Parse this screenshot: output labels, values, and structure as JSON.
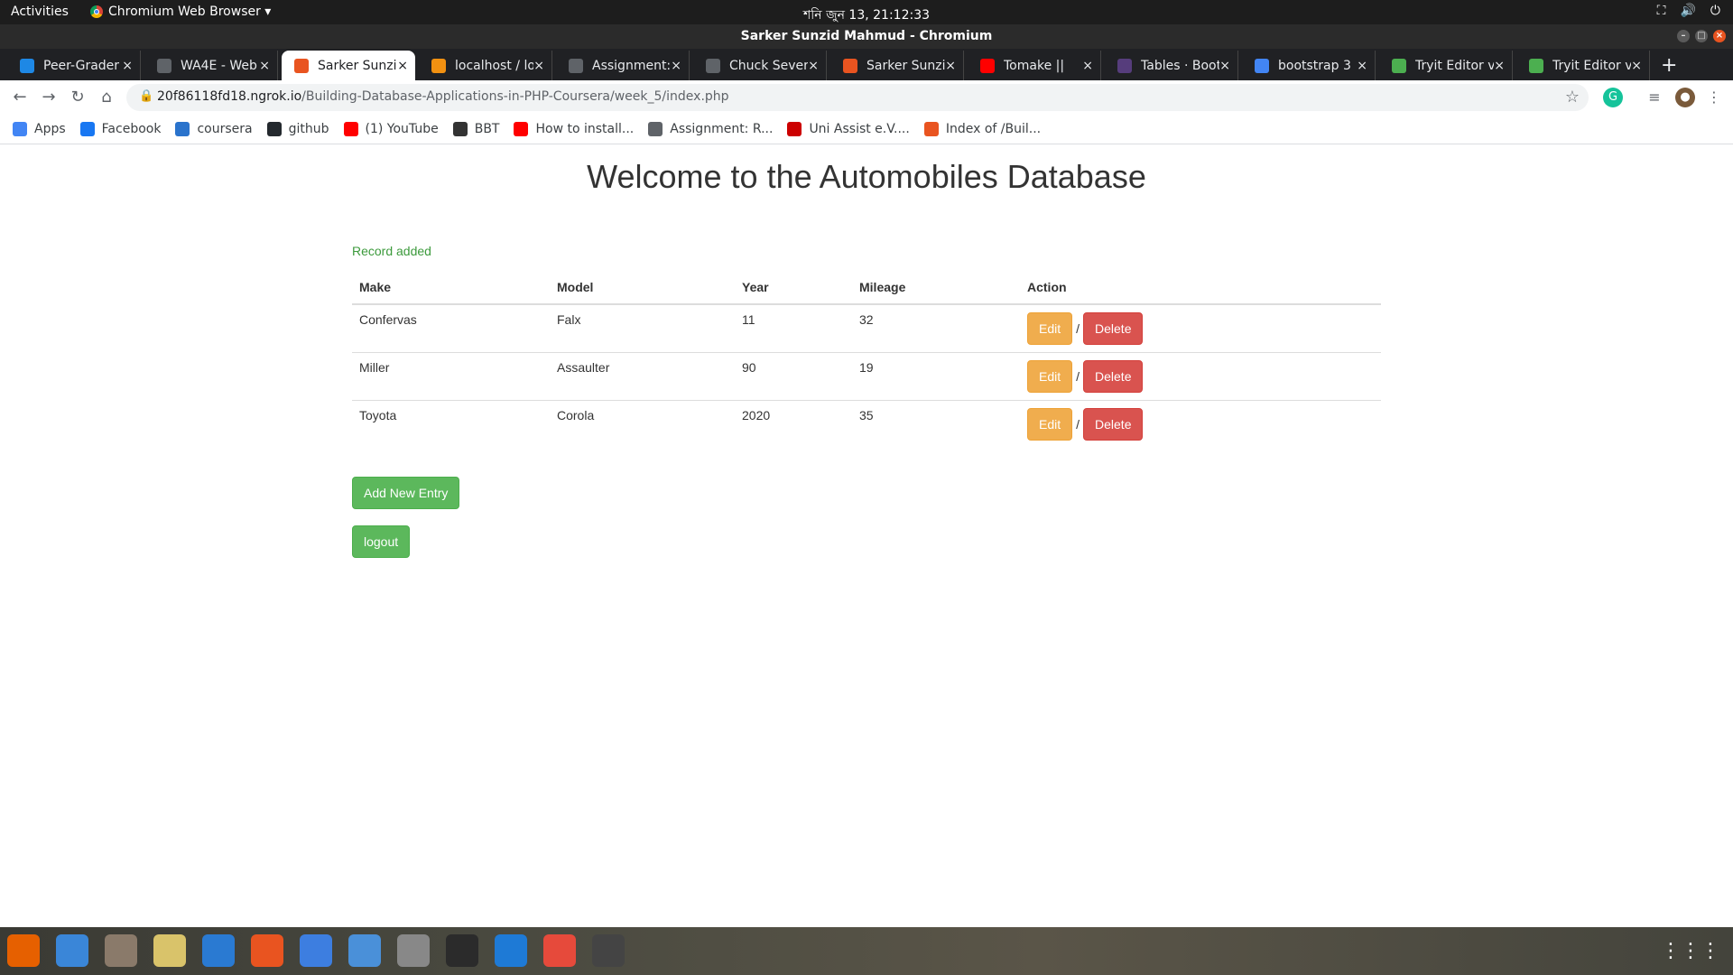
{
  "system": {
    "activities": "Activities",
    "app_menu": "Chromium Web Browser ▾",
    "clock": "শনি জুন 13, 21:12:33"
  },
  "window": {
    "title": "Sarker Sunzid Mahmud - Chromium"
  },
  "tabs": [
    {
      "label": "Peer-Grader",
      "favicon_color": "#1e88e5",
      "icon": "coursera-icon"
    },
    {
      "label": "WA4E - Web",
      "favicon_color": "#5f6368",
      "icon": "wa4e-icon"
    },
    {
      "label": "Sarker Sunzid",
      "favicon_color": "#e95420",
      "icon": "ngrok-icon"
    },
    {
      "label": "localhost / lo",
      "favicon_color": "#f29111",
      "icon": "phpmyadmin-icon"
    },
    {
      "label": "Assignment:",
      "favicon_color": "#5f6368",
      "icon": "wa4e-icon"
    },
    {
      "label": "Chuck Severa",
      "favicon_color": "#5f6368",
      "icon": "wa4e-icon"
    },
    {
      "label": "Sarker Sunzid",
      "favicon_color": "#e95420",
      "icon": "ngrok-icon"
    },
    {
      "label": "Tomake ||",
      "favicon_color": "#ff0000",
      "icon": "youtube-icon"
    },
    {
      "label": "Tables · Boot",
      "favicon_color": "#563d7c",
      "icon": "bootstrap-icon"
    },
    {
      "label": "bootstrap 3",
      "favicon_color": "#4285f4",
      "icon": "google-icon"
    },
    {
      "label": "Tryit Editor v",
      "favicon_color": "#4caf50",
      "icon": "w3schools-icon"
    },
    {
      "label": "Tryit Editor v",
      "favicon_color": "#4caf50",
      "icon": "w3schools-icon"
    }
  ],
  "active_tab": 2,
  "address_bar": {
    "host": "20f86118fd18.ngrok.io",
    "path": "/Building-Database-Applications-in-PHP-Coursera/week_5/index.php"
  },
  "bookmarks": [
    {
      "label": "Apps",
      "color": "#4285f4",
      "icon": "apps-grid-icon"
    },
    {
      "label": "Facebook",
      "color": "#1877f2",
      "icon": "facebook-icon"
    },
    {
      "label": "coursera",
      "color": "#2a73cc",
      "icon": "coursera-icon"
    },
    {
      "label": "github",
      "color": "#24292e",
      "icon": "github-icon"
    },
    {
      "label": "(1) YouTube",
      "color": "#ff0000",
      "icon": "youtube-icon"
    },
    {
      "label": "BBT",
      "color": "#333333",
      "icon": "globe-icon"
    },
    {
      "label": "How to install...",
      "color": "#ff0000",
      "icon": "youtube-icon"
    },
    {
      "label": "Assignment: R...",
      "color": "#5f6368",
      "icon": "wa4e-icon"
    },
    {
      "label": "Uni Assist e.V....",
      "color": "#cc0000",
      "icon": "uni-assist-icon"
    },
    {
      "label": "Index of /Buil...",
      "color": "#e95420",
      "icon": "ngrok-icon"
    }
  ],
  "page": {
    "heading": "Welcome to the Automobiles Database",
    "flash": "Record added",
    "columns": [
      "Make",
      "Model",
      "Year",
      "Mileage",
      "Action"
    ],
    "rows": [
      {
        "make": "Confervas",
        "model": "Falx",
        "year": "11",
        "mileage": "32"
      },
      {
        "make": "Miller",
        "model": "Assaulter",
        "year": "90",
        "mileage": "19"
      },
      {
        "make": "Toyota",
        "model": "Corola",
        "year": "2020",
        "mileage": "35"
      }
    ],
    "edit_label": "Edit",
    "delete_label": "Delete",
    "separator": "/",
    "add_label": "Add New Entry",
    "logout_label": "logout"
  },
  "colors": {
    "success": "#5cb85c",
    "warning": "#f0ad4e",
    "danger": "#d9534f",
    "flash_text": "#3c9a3c"
  },
  "dock": [
    {
      "icon": "firefox-icon",
      "color": "#e66000"
    },
    {
      "icon": "thunderbird-icon",
      "color": "#3a86d8"
    },
    {
      "icon": "files-icon",
      "color": "#8a7a6a"
    },
    {
      "icon": "rhythmbox-icon",
      "color": "#d9c36a"
    },
    {
      "icon": "libreoffice-writer-icon",
      "color": "#2a7ad2"
    },
    {
      "icon": "software-center-icon",
      "color": "#e95420"
    },
    {
      "icon": "help-icon",
      "color": "#3d7ee0"
    },
    {
      "icon": "chromium-icon",
      "color": "#4a90d9"
    },
    {
      "icon": "screenshot-icon",
      "color": "#888888"
    },
    {
      "icon": "terminal-icon",
      "color": "#2b2b2b"
    },
    {
      "icon": "vscode-icon",
      "color": "#1e7ad6"
    },
    {
      "icon": "git-icon",
      "color": "#e64a3b"
    },
    {
      "icon": "screen-recorder-icon",
      "color": "#444444"
    }
  ]
}
